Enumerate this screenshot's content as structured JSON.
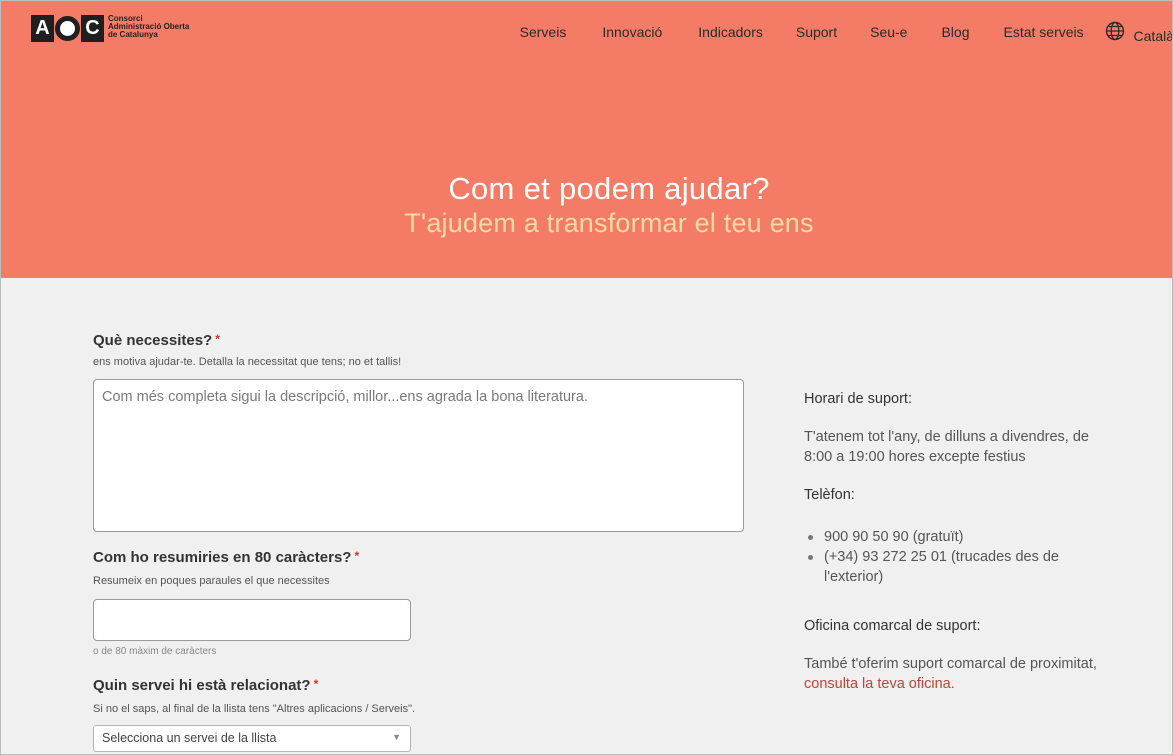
{
  "logo": {
    "mark": [
      "A",
      "C"
    ],
    "line1": "Consorci",
    "line2": "Administració Oberta",
    "line3": "de Catalunya"
  },
  "nav": {
    "items": [
      "Serveis",
      "Innovació",
      "Indicadors",
      "Suport",
      "Seu-e",
      "Blog",
      "Estat serveis"
    ],
    "language": "Català",
    "language_icon": "globe-icon"
  },
  "hero": {
    "title": "Com et podem ajudar?",
    "subtitle": "T'ajudem a transformar el teu ens"
  },
  "form": {
    "need": {
      "label": "Què necessites?",
      "required": "*",
      "help": "ens motiva ajudar-te. Detalla la necessitat que tens; no et tallis!",
      "placeholder": "Com més completa sigui la descripció, millor...ens agrada la bona literatura."
    },
    "summary": {
      "label": "Com ho resumiries en 80 caràcters?",
      "required": "*",
      "help": "Resumeix en poques paraules el que necessites",
      "value": "",
      "counter": "o de 80 màxim de caràcters"
    },
    "service": {
      "label": "Quin servei hi està relacionat?",
      "required": "*",
      "help": "Si no el saps, al final de la llista tens \"Altres aplicacions / Serveis\".",
      "selected": "Selecciona un servei de la llista"
    }
  },
  "sidebar": {
    "hours_title": "Horari de suport:",
    "hours_text": "T'atenem tot l'any, de dilluns a divendres, de 8:00 a 19:00 hores excepte festius",
    "phone_title": "Telèfon:",
    "phones": [
      "900 90 50 90 (gratuït)",
      "(+34) 93 272 25 01 (trucades des de l'exterior)"
    ],
    "office_title": "Oficina comarcal de suport:",
    "office_text": "També t'oferim suport comarcal de proximitat,",
    "office_link": "consulta la teva oficina."
  },
  "colors": {
    "hero_bg": "#f47c67",
    "hero_subtitle": "#f9d9a4",
    "page_bg": "#f0f0f0",
    "required": "#d9301d",
    "link": "#c1443a"
  }
}
